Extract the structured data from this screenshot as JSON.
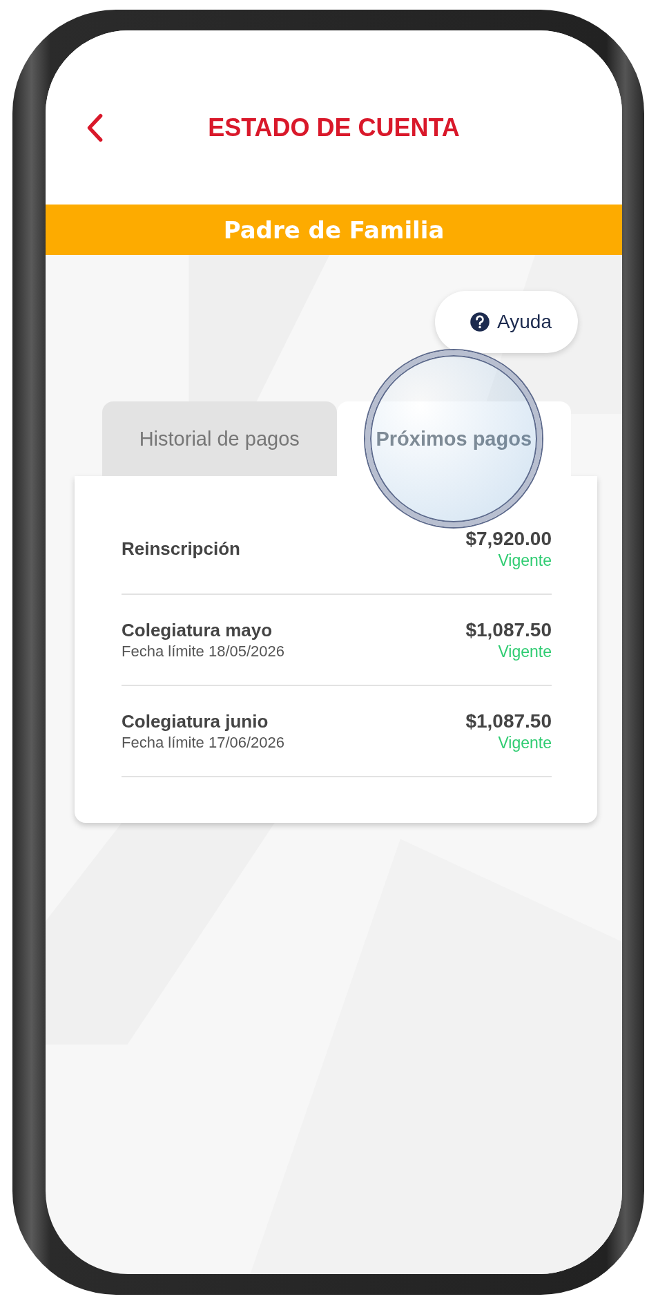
{
  "header": {
    "title": "ESTADO DE CUENTA"
  },
  "banner": {
    "label": "Padre de Familia"
  },
  "help_button": {
    "label": "Ayuda"
  },
  "tabs": [
    {
      "label": "Historial de pagos",
      "selected": false,
      "magnified": false
    },
    {
      "label": "Próximos pagos",
      "selected": true,
      "magnified": true
    }
  ],
  "payments": [
    {
      "concept": "Reinscripción",
      "amount": "$7,920.00",
      "status": "Vigente"
    },
    {
      "concept": "Colegiatura mayo",
      "due": "Fecha límite 18/05/2026",
      "amount": "$1,087.50",
      "status": "Vigente"
    },
    {
      "concept": "Colegiatura junio",
      "due": "Fecha límite 17/06/2026",
      "amount": "$1,087.50",
      "status": "Vigente"
    }
  ]
}
